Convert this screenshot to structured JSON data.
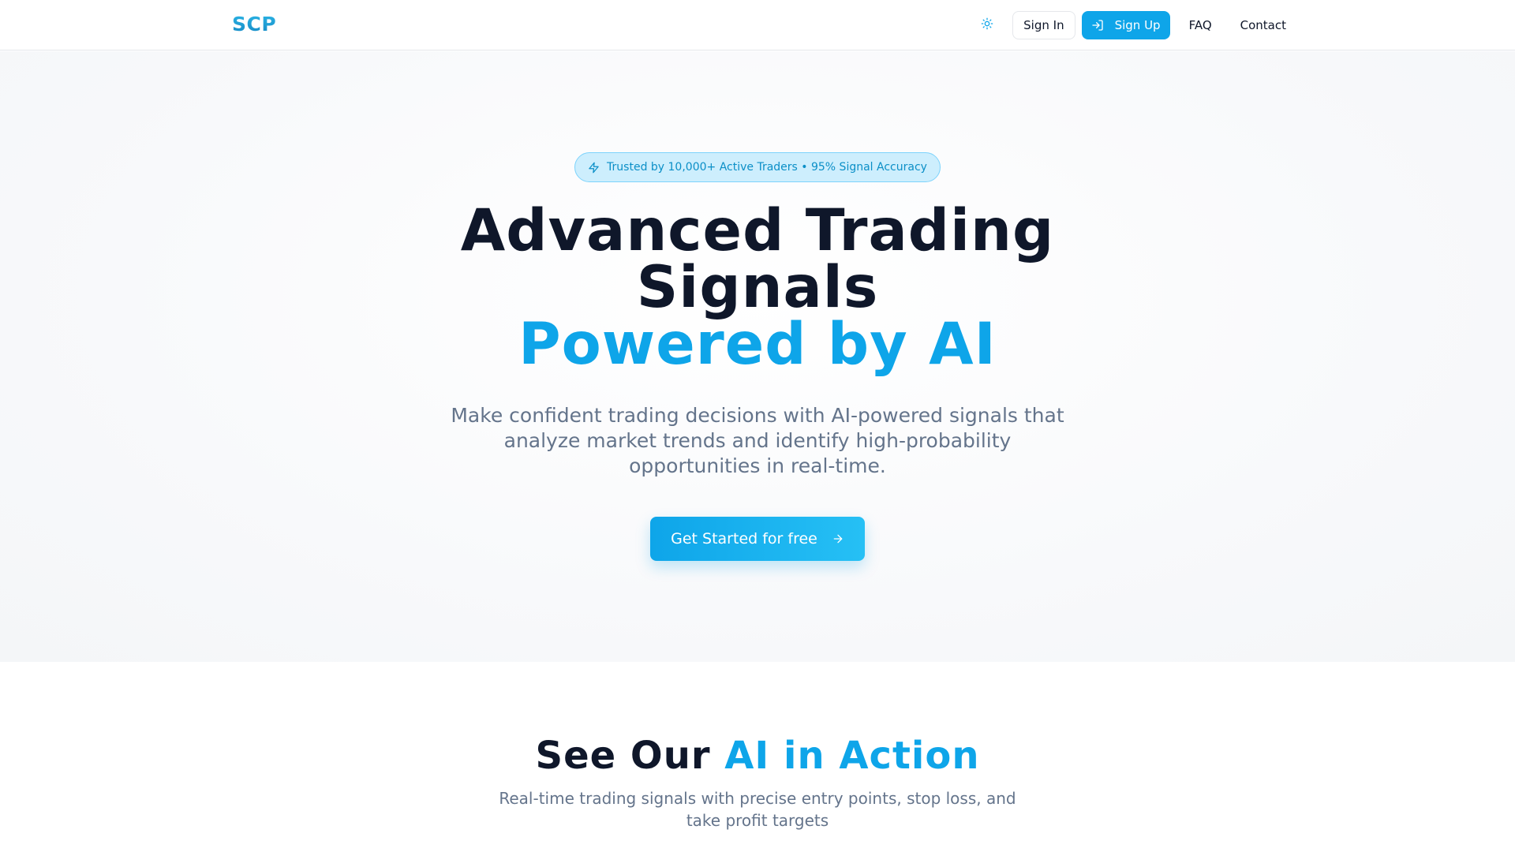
{
  "navbar": {
    "logo": "SCP",
    "sign_in": "Sign In",
    "sign_up": "Sign Up",
    "links": [
      "FAQ",
      "Contact"
    ],
    "icons": {
      "theme": "sun-icon",
      "sign_up": "log-in-icon"
    }
  },
  "hero": {
    "badge": "Trusted by 10,000+ Active Traders • 95% Signal Accuracy",
    "title_line1": "Advanced Trading Signals",
    "title_accent": "Powered by AI",
    "subtitle": "Make confident trading decisions with AI-powered signals that analyze market trends and identify high-probability opportunities in real-time.",
    "cta": "Get Started for free",
    "icons": {
      "badge": "zap-icon",
      "cta": "arrow-right-icon"
    }
  },
  "section": {
    "title_plain": "See Our",
    "title_accent": "AI in Action",
    "subtitle": "Real-time trading signals with precise entry points, stop loss, and take profit targets"
  },
  "colors": {
    "accent": "#0ea5e9",
    "text": "#0f172a",
    "muted": "#64748b"
  }
}
